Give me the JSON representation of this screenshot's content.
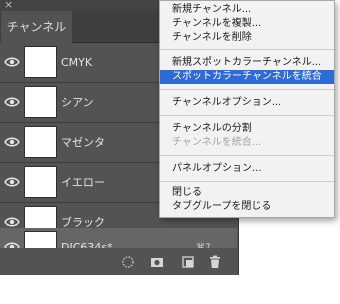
{
  "panel": {
    "close_glyph": "×",
    "tab_label": "チャンネル",
    "channels": [
      {
        "name": "CMYK",
        "shortcut": ""
      },
      {
        "name": "シアン",
        "shortcut": ""
      },
      {
        "name": "マゼンタ",
        "shortcut": ""
      },
      {
        "name": "イエロー",
        "shortcut": ""
      },
      {
        "name": "ブラック",
        "shortcut": ""
      },
      {
        "name": "DIC634s*",
        "shortcut": "⌘7",
        "selected": true
      }
    ],
    "bottom_icons": [
      "load-selection-icon",
      "save-selection-icon",
      "new-channel-icon",
      "delete-icon"
    ]
  },
  "menu": {
    "items": [
      {
        "label": "新規チャンネル..."
      },
      {
        "label": "チャンネルを複製..."
      },
      {
        "label": "チャンネルを削除"
      },
      {
        "label": "新規スポットカラーチャンネル..."
      },
      {
        "label": "スポットカラーチャンネルを統合",
        "highlighted": true
      },
      {
        "label": "チャンネルオプション..."
      },
      {
        "label": "チャンネルの分割"
      },
      {
        "label": "チャンネルを統合...",
        "disabled": true
      },
      {
        "label": "パネルオプション..."
      },
      {
        "label": "閉じる"
      },
      {
        "label": "タブグループを閉じる"
      }
    ]
  },
  "colors": {
    "panel_bg": "#535353",
    "selected_row": "#666666",
    "menu_bg": "#f2f2f2",
    "menu_highlight": "#2f6bd4"
  }
}
